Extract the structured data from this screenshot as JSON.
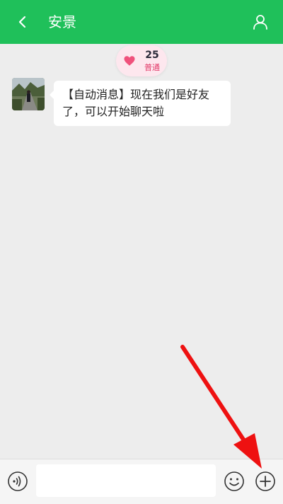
{
  "header": {
    "title": "安景",
    "back_icon": "back-arrow-icon",
    "profile_icon": "person-icon",
    "color": "#1fc05a"
  },
  "intimacy": {
    "score": "25",
    "level": "普通",
    "icon": "heart-icon",
    "heart_color": "#f0517c"
  },
  "messages": [
    {
      "sender_avatar": "avatar-photo",
      "text_line1": "【自动消息】现在我们是好友",
      "text_line2": "了，可以开始聊天啦"
    }
  ],
  "input_bar": {
    "voice_icon": "voice-icon",
    "text_value": "",
    "emoji_icon": "emoji-icon",
    "plus_icon": "plus-icon"
  },
  "annotation": {
    "type": "red-arrow",
    "target": "plus-button",
    "color": "#ee1111"
  }
}
